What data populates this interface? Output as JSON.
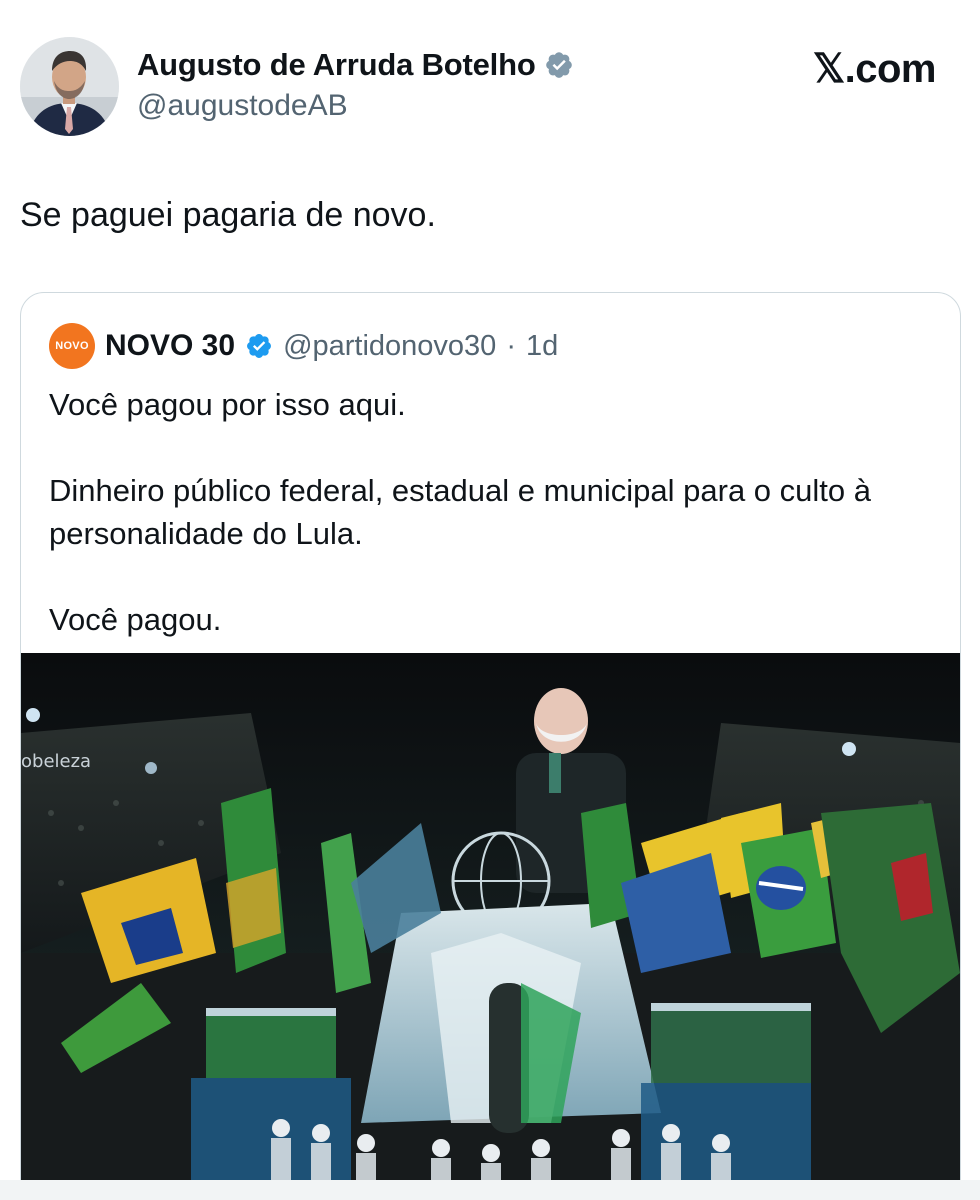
{
  "author": {
    "name": "Augusto de Arruda Botelho",
    "handle": "@augustodeAB",
    "verified_icon": "verified-badge-icon"
  },
  "brand": {
    "label": "𝕏.com"
  },
  "tweet": {
    "text": "Se paguei pagaria de novo."
  },
  "quoted": {
    "avatar_label": "NOVO",
    "name": "NOVO 30",
    "handle": "@partidonovo30",
    "separator": "·",
    "time": "1d",
    "paragraphs": [
      "Você pagou por isso aqui.",
      "Dinheiro público federal, estadual e municipal para o culto à personalidade do Lula.",
      "Você pagou."
    ],
    "media": {
      "overlay_text": "obeleza"
    }
  },
  "colors": {
    "verified_blue": "#1d9bf0",
    "verified_gray": "#829aab",
    "novo_orange": "#f2751f",
    "secondary_text": "#536471"
  }
}
